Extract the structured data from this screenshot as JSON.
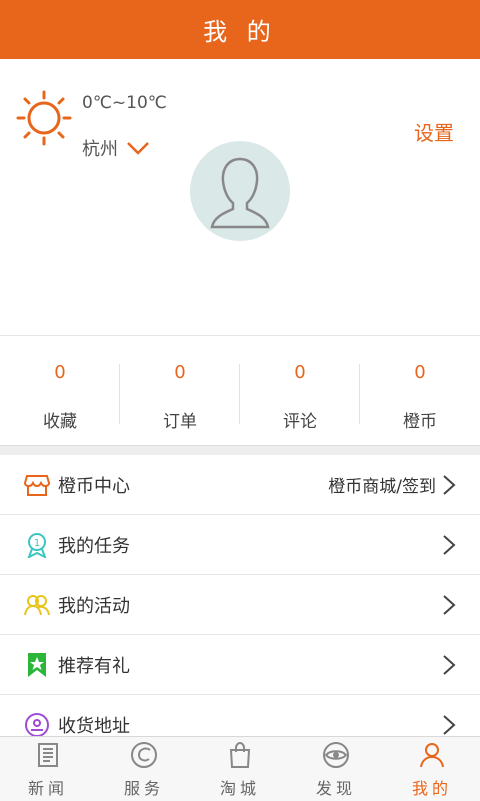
{
  "topbar": {
    "title": "我 的"
  },
  "weather": {
    "temperature": "0℃~10℃",
    "city": "杭州",
    "icon": "sun-icon"
  },
  "header": {
    "settings_label": "设置",
    "avatar_icon": "user-silhouette-icon"
  },
  "stats": [
    {
      "value": "0",
      "label": "收藏"
    },
    {
      "value": "0",
      "label": "订单"
    },
    {
      "value": "0",
      "label": "评论"
    },
    {
      "value": "0",
      "label": "橙币"
    }
  ],
  "menu": [
    {
      "label": "橙币中心",
      "extra": "橙币商城/签到",
      "icon": "shop-icon"
    },
    {
      "label": "我的任务",
      "extra": "",
      "icon": "medal-icon"
    },
    {
      "label": "我的活动",
      "extra": "",
      "icon": "group-icon"
    },
    {
      "label": "推荐有礼",
      "extra": "",
      "icon": "bookmark-star-icon"
    },
    {
      "label": "收货地址",
      "extra": "",
      "icon": "location-icon"
    }
  ],
  "tabs": [
    {
      "label": "新闻",
      "icon": "newspaper-icon",
      "active": false
    },
    {
      "label": "服务",
      "icon": "service-icon",
      "active": false
    },
    {
      "label": "淘城",
      "icon": "shopping-bag-icon",
      "active": false
    },
    {
      "label": "发现",
      "icon": "discover-eye-icon",
      "active": false
    },
    {
      "label": "我的",
      "icon": "profile-icon",
      "active": true
    }
  ],
  "colors": {
    "accent": "#e8661c",
    "background": "#ffffff"
  }
}
